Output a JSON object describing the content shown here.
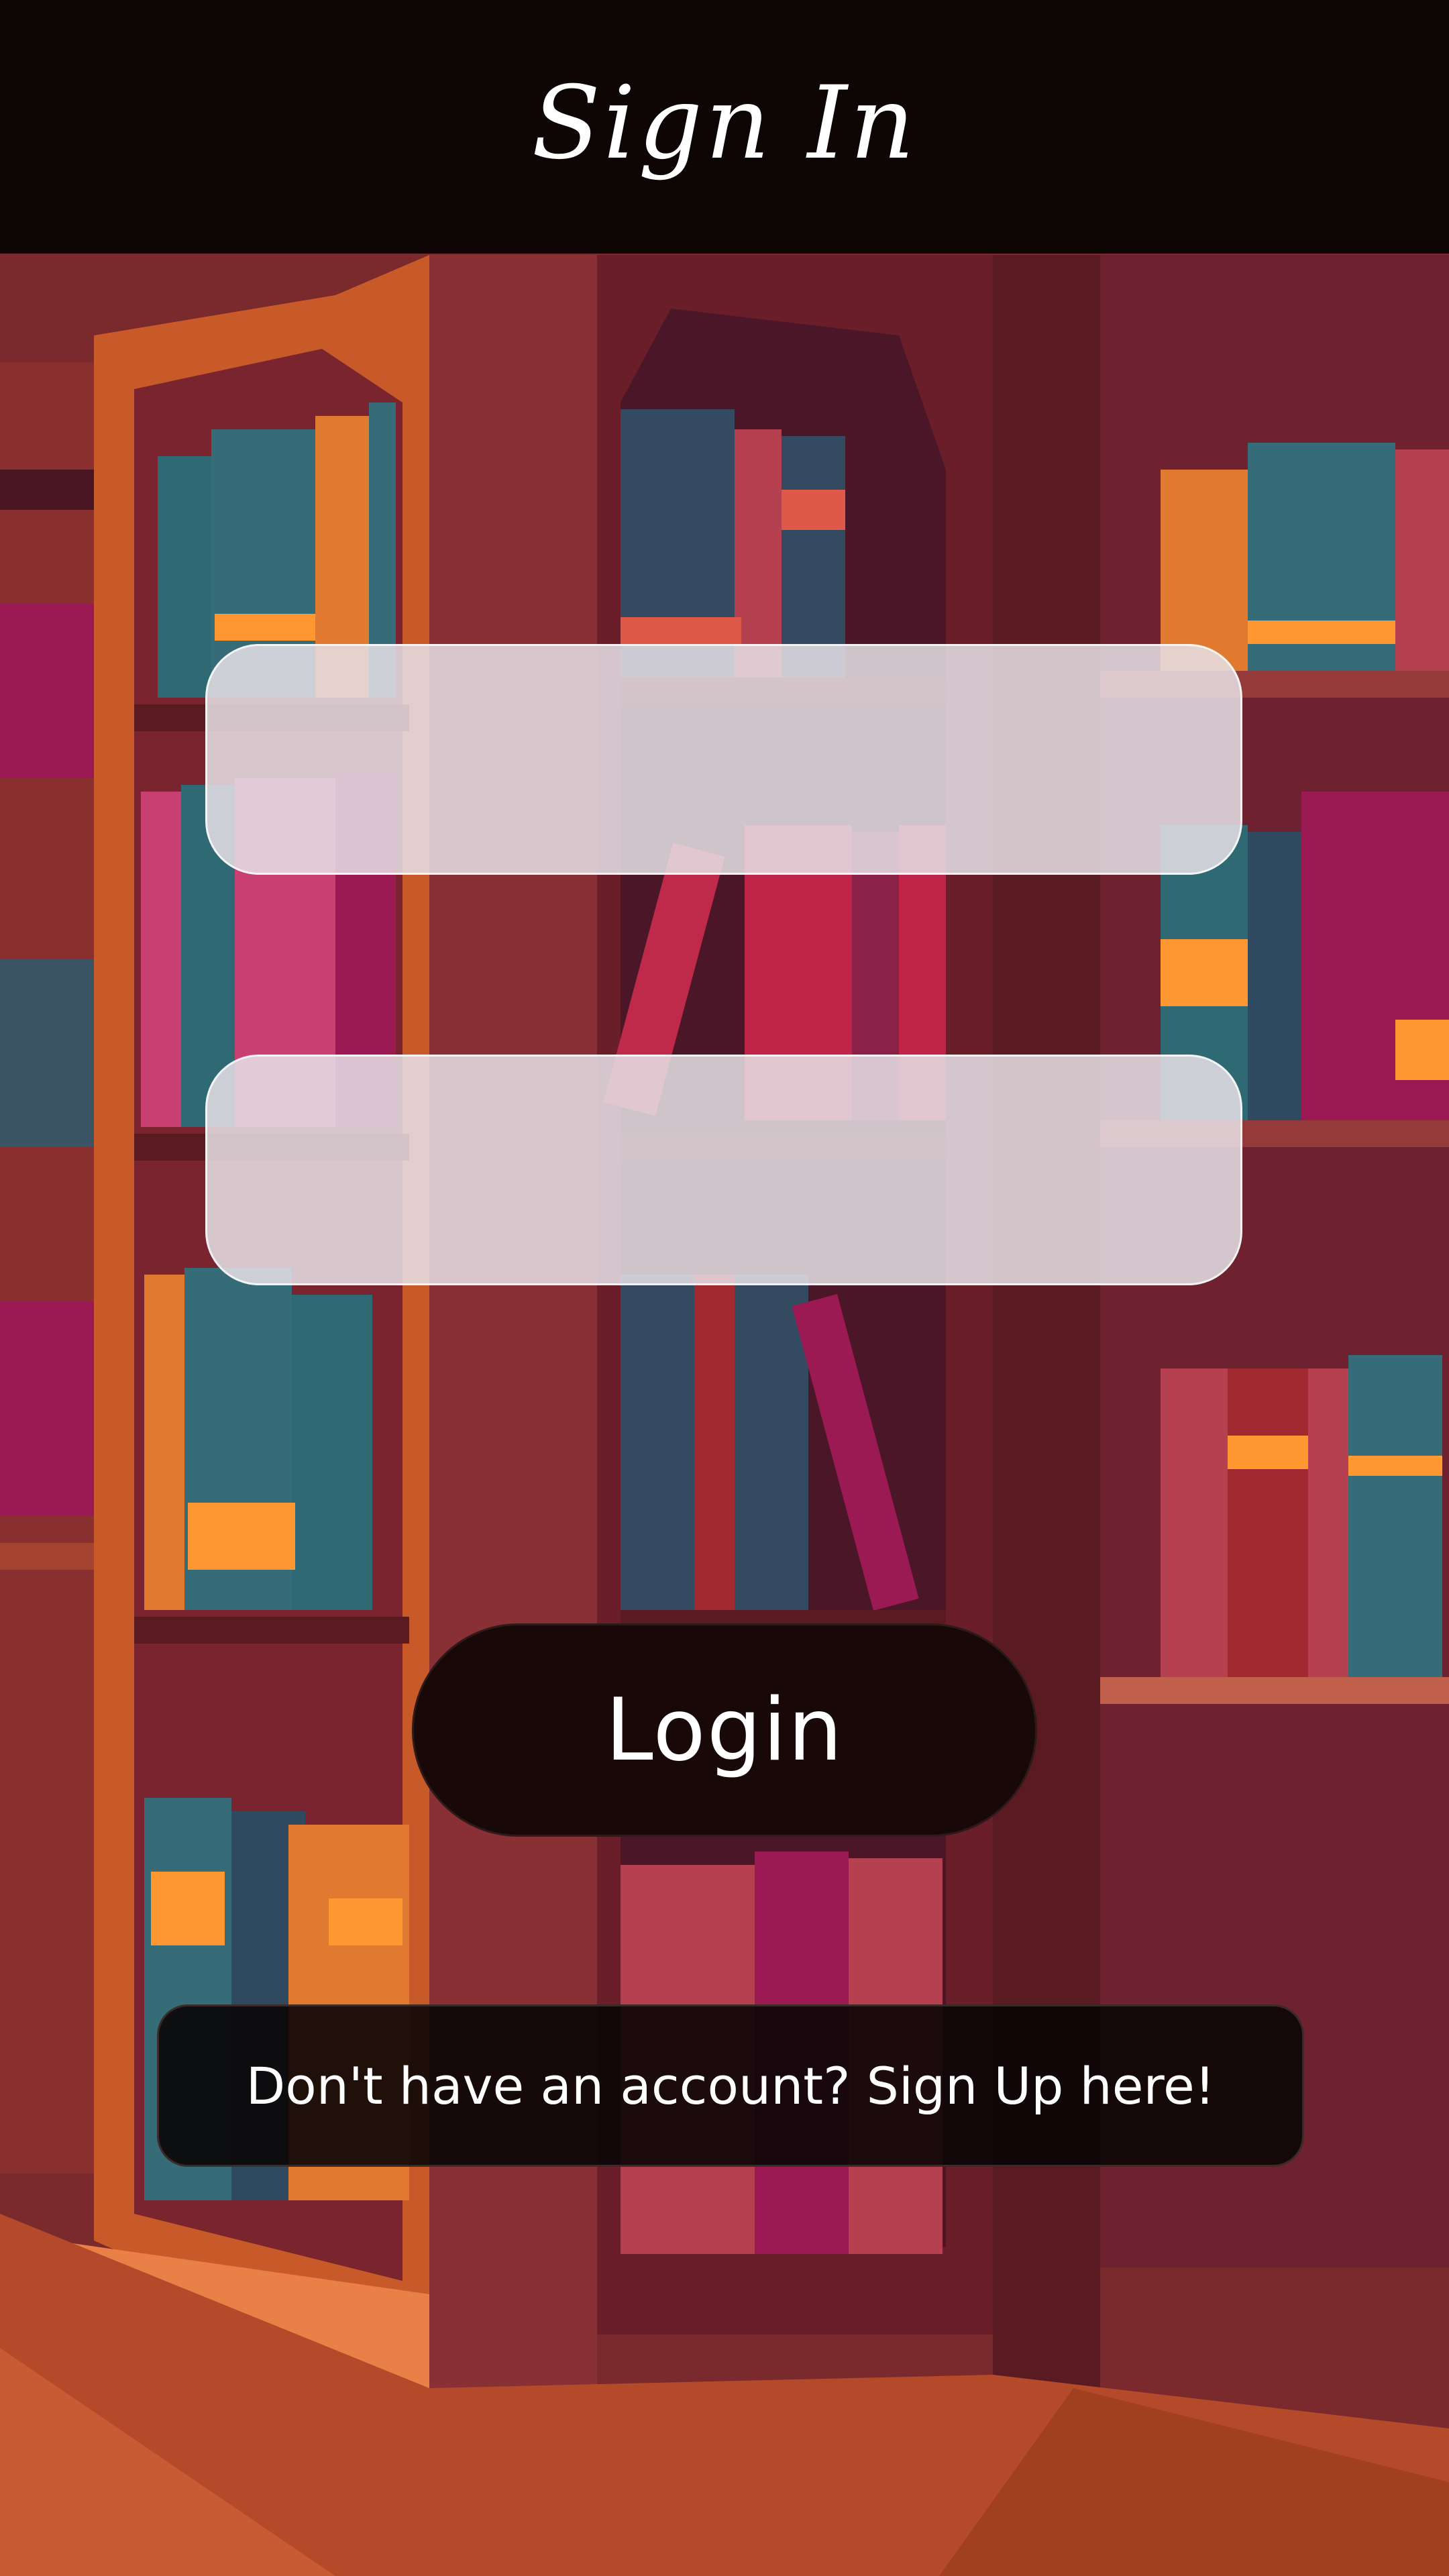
{
  "header": {
    "title": "Sign In"
  },
  "form": {
    "username": {
      "value": "",
      "placeholder": ""
    },
    "password": {
      "value": "",
      "placeholder": ""
    },
    "login_label": "Login",
    "signup_label": "Don't have an account? Sign Up here!"
  },
  "colors": {
    "header_bg": "#0e0505",
    "field_bg": "#e6e1e6",
    "button_bg": "#180908",
    "text": "#ffffff"
  }
}
